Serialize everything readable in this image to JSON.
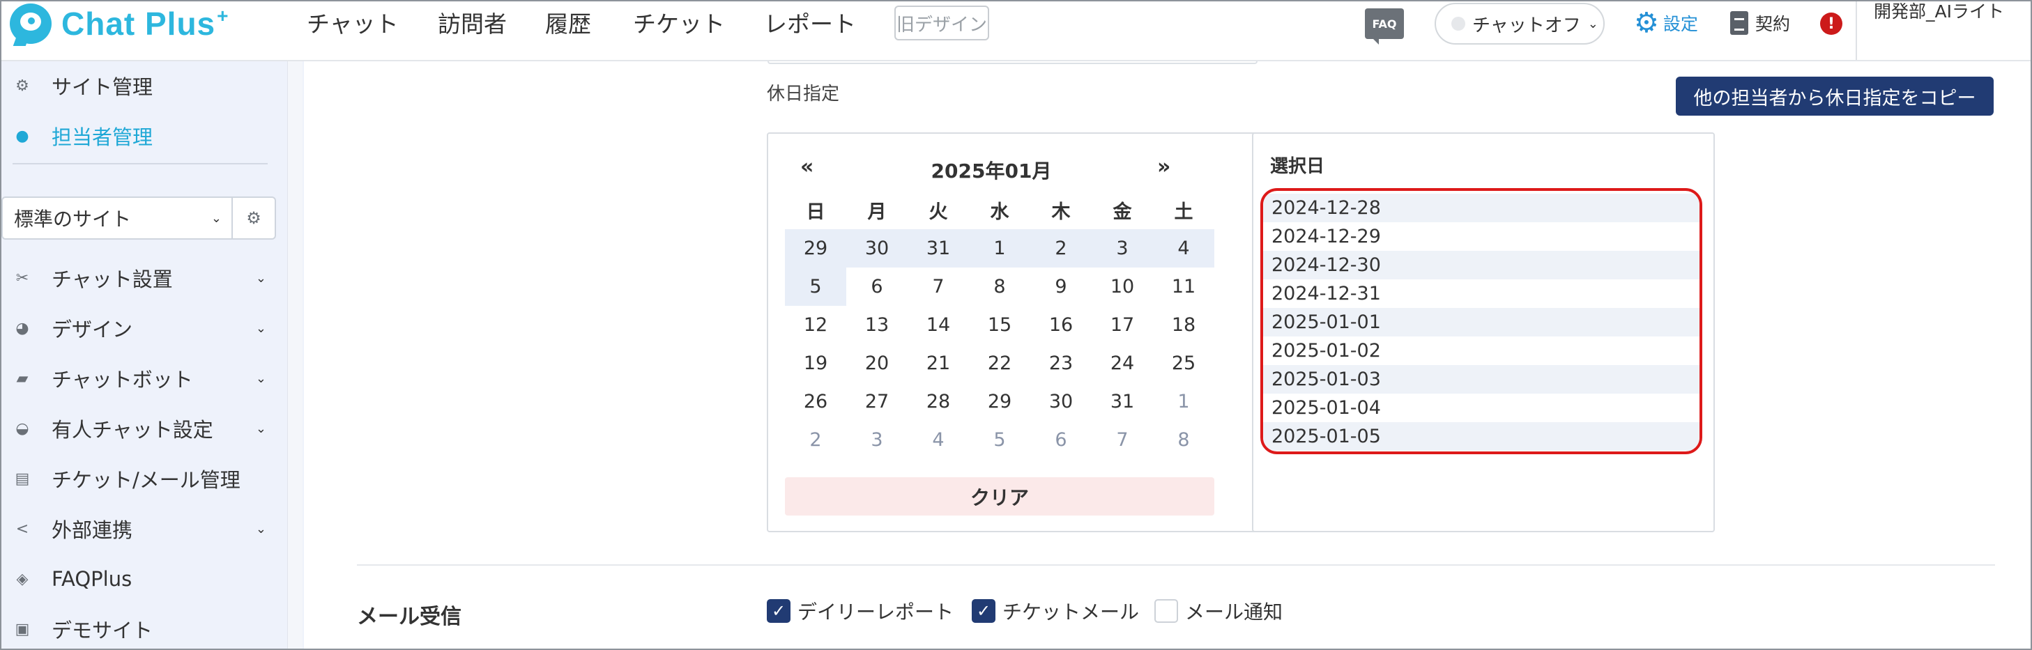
{
  "header": {
    "logo_text": "Chat Plus",
    "logo_plus": "+",
    "nav": [
      "チャット",
      "訪問者",
      "履歴",
      "チケット",
      "レポート"
    ],
    "old_design": "旧デザイン",
    "faq_label": "FAQ",
    "chat_status": "チャットオフ",
    "settings_label": "設定",
    "contract_label": "契約",
    "alert_mark": "!",
    "user_name": "開発部_AIライト"
  },
  "sidebar": {
    "site_admin": "サイト管理",
    "staff_admin": "担当者管理",
    "site_select": "標準のサイト",
    "items": [
      "チャット設置",
      "デザイン",
      "チャットボット",
      "有人チャット設定",
      "チケット/メール管理",
      "外部連携",
      "FAQPlus",
      "デモサイト"
    ]
  },
  "holiday": {
    "label": "休日指定",
    "copy_button": "他の担当者から休日指定をコピー",
    "calendar": {
      "prev": "«",
      "next": "»",
      "title": "2025年01月",
      "weekdays": [
        "日",
        "月",
        "火",
        "水",
        "木",
        "金",
        "土"
      ],
      "weeks": [
        [
          "29",
          "30",
          "31",
          "1",
          "2",
          "3",
          "4"
        ],
        [
          "5",
          "6",
          "7",
          "8",
          "9",
          "10",
          "11"
        ],
        [
          "12",
          "13",
          "14",
          "15",
          "16",
          "17",
          "18"
        ],
        [
          "19",
          "20",
          "21",
          "22",
          "23",
          "24",
          "25"
        ],
        [
          "26",
          "27",
          "28",
          "29",
          "30",
          "31",
          "1"
        ],
        [
          "2",
          "3",
          "4",
          "5",
          "6",
          "7",
          "8"
        ]
      ],
      "clear_label": "クリア"
    },
    "selected_title": "選択日",
    "selected_dates": [
      "2024-12-28",
      "2024-12-29",
      "2024-12-30",
      "2024-12-31",
      "2025-01-01",
      "2025-01-02",
      "2025-01-03",
      "2025-01-04",
      "2025-01-05"
    ]
  },
  "mail": {
    "label": "メール受信",
    "options": [
      {
        "label": "デイリーレポート",
        "checked": true
      },
      {
        "label": "チケットメール",
        "checked": true
      },
      {
        "label": "メール通知",
        "checked": false
      }
    ]
  },
  "colors": {
    "brand": "#2db7de",
    "primary_button": "#213b73",
    "highlight_border": "#dd1a1a",
    "selected_cell": "#e8eef8"
  }
}
